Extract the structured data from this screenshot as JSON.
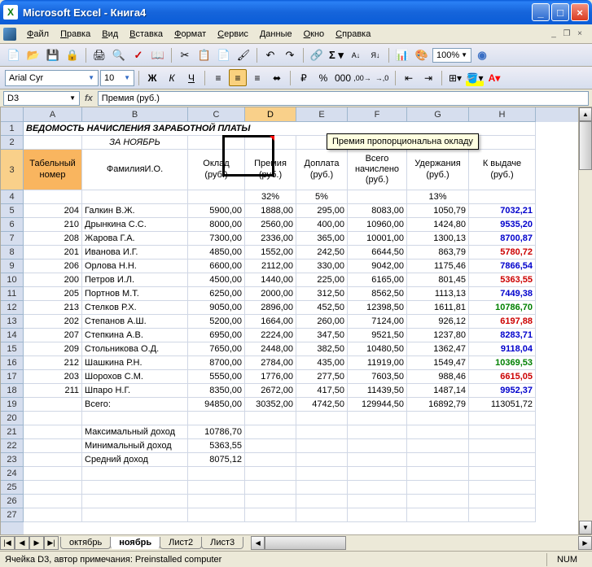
{
  "title": "Microsoft Excel - Книга4",
  "menus": [
    "Файл",
    "Правка",
    "Вид",
    "Вставка",
    "Формат",
    "Сервис",
    "Данные",
    "Окно",
    "Справка"
  ],
  "zoom": "100%",
  "font": "Arial Cyr",
  "fontsize": "10",
  "namebox": "D3",
  "formula": "Премия (руб.)",
  "comment_text": "Премия пропорциональна окладу",
  "columns": [
    "A",
    "B",
    "C",
    "D",
    "E",
    "F",
    "G",
    "H"
  ],
  "header_row1": "ВЕДОМОСТЬ НАЧИСЛЕНИЯ ЗАРАБОТНОЙ ПЛАТЫ",
  "header_row2": "ЗА НОЯБРЬ",
  "headers": {
    "A": "Табельный номер",
    "B": "ФамилияИ.О.",
    "C": "Оклад (руб.)",
    "D": "Премия (руб.)",
    "E": "Доплата (руб.)",
    "F": "Всего начислено (руб.)",
    "G": "Удержания (руб.)",
    "H": "К выдаче (руб.)"
  },
  "percents": {
    "D": "32%",
    "E": "5%",
    "G": "13%"
  },
  "rows": [
    {
      "n": "204",
      "name": "Галкин В.Ж.",
      "c": "5900,00",
      "d": "1888,00",
      "e": "295,00",
      "f": "8083,00",
      "g": "1050,79",
      "h": "7032,21",
      "cls": "blue"
    },
    {
      "n": "210",
      "name": "Дрынкина С.С.",
      "c": "8000,00",
      "d": "2560,00",
      "e": "400,00",
      "f": "10960,00",
      "g": "1424,80",
      "h": "9535,20",
      "cls": "blue"
    },
    {
      "n": "208",
      "name": "Жарова Г.А.",
      "c": "7300,00",
      "d": "2336,00",
      "e": "365,00",
      "f": "10001,00",
      "g": "1300,13",
      "h": "8700,87",
      "cls": "blue"
    },
    {
      "n": "201",
      "name": "Иванова И.Г.",
      "c": "4850,00",
      "d": "1552,00",
      "e": "242,50",
      "f": "6644,50",
      "g": "863,79",
      "h": "5780,72",
      "cls": "red"
    },
    {
      "n": "206",
      "name": "Орлова Н.Н.",
      "c": "6600,00",
      "d": "2112,00",
      "e": "330,00",
      "f": "9042,00",
      "g": "1175,46",
      "h": "7866,54",
      "cls": "blue"
    },
    {
      "n": "200",
      "name": "Петров И.Л.",
      "c": "4500,00",
      "d": "1440,00",
      "e": "225,00",
      "f": "6165,00",
      "g": "801,45",
      "h": "5363,55",
      "cls": "red"
    },
    {
      "n": "205",
      "name": "Портнов М.Т.",
      "c": "6250,00",
      "d": "2000,00",
      "e": "312,50",
      "f": "8562,50",
      "g": "1113,13",
      "h": "7449,38",
      "cls": "blue"
    },
    {
      "n": "213",
      "name": "Стелков Р.Х.",
      "c": "9050,00",
      "d": "2896,00",
      "e": "452,50",
      "f": "12398,50",
      "g": "1611,81",
      "h": "10786,70",
      "cls": "green"
    },
    {
      "n": "202",
      "name": "Степанов А.Ш.",
      "c": "5200,00",
      "d": "1664,00",
      "e": "260,00",
      "f": "7124,00",
      "g": "926,12",
      "h": "6197,88",
      "cls": "red"
    },
    {
      "n": "207",
      "name": "Степкина А.В.",
      "c": "6950,00",
      "d": "2224,00",
      "e": "347,50",
      "f": "9521,50",
      "g": "1237,80",
      "h": "8283,71",
      "cls": "blue"
    },
    {
      "n": "209",
      "name": "Стольникова О.Д.",
      "c": "7650,00",
      "d": "2448,00",
      "e": "382,50",
      "f": "10480,50",
      "g": "1362,47",
      "h": "9118,04",
      "cls": "blue"
    },
    {
      "n": "212",
      "name": "Шашкина Р.Н.",
      "c": "8700,00",
      "d": "2784,00",
      "e": "435,00",
      "f": "11919,00",
      "g": "1549,47",
      "h": "10369,53",
      "cls": "green"
    },
    {
      "n": "203",
      "name": "Шорохов С.М.",
      "c": "5550,00",
      "d": "1776,00",
      "e": "277,50",
      "f": "7603,50",
      "g": "988,46",
      "h": "6615,05",
      "cls": "red"
    },
    {
      "n": "211",
      "name": "Шпаро Н.Г.",
      "c": "8350,00",
      "d": "2672,00",
      "e": "417,50",
      "f": "11439,50",
      "g": "1487,14",
      "h": "9952,37",
      "cls": "blue"
    }
  ],
  "totals": {
    "label": "Всего:",
    "c": "94850,00",
    "d": "30352,00",
    "e": "4742,50",
    "f": "129944,50",
    "g": "16892,79",
    "h": "113051,72"
  },
  "stats": [
    {
      "label": "Максимальный доход",
      "val": "10786,70"
    },
    {
      "label": "Минимальный доход",
      "val": "5363,55"
    },
    {
      "label": "Средний доход",
      "val": "8075,12"
    }
  ],
  "sheets": [
    "октябрь",
    "ноябрь",
    "Лист2",
    "Лист3"
  ],
  "active_sheet": 1,
  "status": "Ячейка D3, автор примечания: Preinstalled computer",
  "status_num": "NUM"
}
